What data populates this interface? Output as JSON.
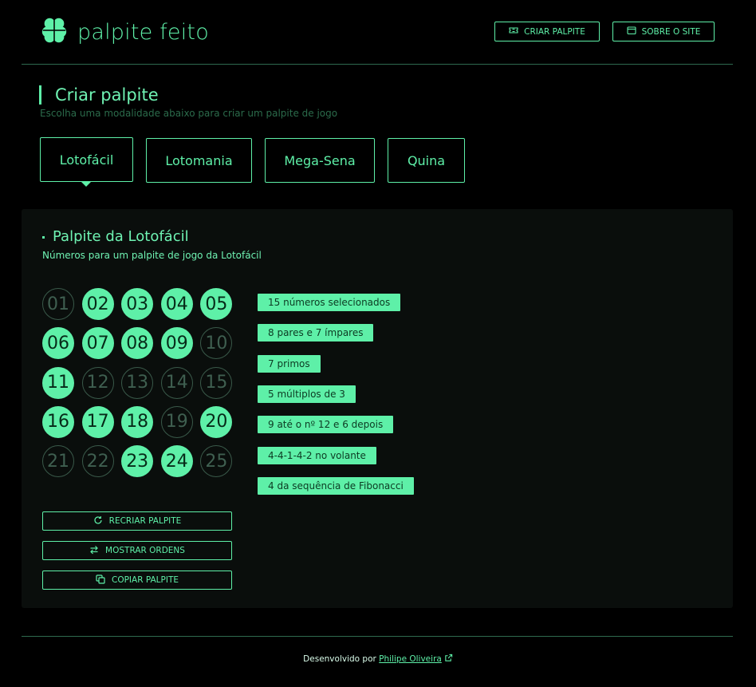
{
  "brand": {
    "name": "palpite feito",
    "icon": "clover-icon",
    "accent": "#5ef0a8",
    "background": "#000000"
  },
  "header": {
    "buttons": [
      {
        "label": "CRIAR PALPITE",
        "icon": "ticket-icon"
      },
      {
        "label": "SOBRE O SITE",
        "icon": "browser-window-icon"
      }
    ]
  },
  "section": {
    "title": "Criar palpite",
    "subtitle": "Escolha uma modalidade abaixo para criar um palpite de jogo"
  },
  "tabs": [
    {
      "label": "Lotofácil",
      "active": true
    },
    {
      "label": "Lotomania",
      "active": false
    },
    {
      "label": "Mega-Sena",
      "active": false
    },
    {
      "label": "Quina",
      "active": false
    }
  ],
  "panel": {
    "title": "Palpite da Lotofácil",
    "subtitle": "Números para um palpite de jogo da Lotofácil",
    "numbers": [
      {
        "n": "01",
        "selected": false
      },
      {
        "n": "02",
        "selected": true
      },
      {
        "n": "03",
        "selected": true
      },
      {
        "n": "04",
        "selected": true
      },
      {
        "n": "05",
        "selected": true
      },
      {
        "n": "06",
        "selected": true
      },
      {
        "n": "07",
        "selected": true
      },
      {
        "n": "08",
        "selected": true
      },
      {
        "n": "09",
        "selected": true
      },
      {
        "n": "10",
        "selected": false
      },
      {
        "n": "11",
        "selected": true
      },
      {
        "n": "12",
        "selected": false
      },
      {
        "n": "13",
        "selected": false
      },
      {
        "n": "14",
        "selected": false
      },
      {
        "n": "15",
        "selected": false
      },
      {
        "n": "16",
        "selected": true
      },
      {
        "n": "17",
        "selected": true
      },
      {
        "n": "18",
        "selected": true
      },
      {
        "n": "19",
        "selected": false
      },
      {
        "n": "20",
        "selected": true
      },
      {
        "n": "21",
        "selected": false
      },
      {
        "n": "22",
        "selected": false
      },
      {
        "n": "23",
        "selected": true
      },
      {
        "n": "24",
        "selected": true
      },
      {
        "n": "25",
        "selected": false
      }
    ],
    "stats": [
      "15 números selecionados",
      "8 pares e 7 ímpares",
      "7 primos",
      "5 múltiplos de 3",
      "9 até o nº 12 e 6 depois",
      "4-4-1-4-2 no volante",
      "4 da sequência de Fibonacci"
    ],
    "actions": [
      {
        "label": "RECRIAR PALPITE",
        "icon": "refresh-icon"
      },
      {
        "label": "MOSTRAR ORDENS",
        "icon": "swap-arrows-icon"
      },
      {
        "label": "COPIAR PALPITE",
        "icon": "copy-icon"
      }
    ]
  },
  "footer": {
    "prefix": "Desenvolvido por",
    "author": "Philipe Oliveira",
    "icon": "external-link-icon"
  }
}
